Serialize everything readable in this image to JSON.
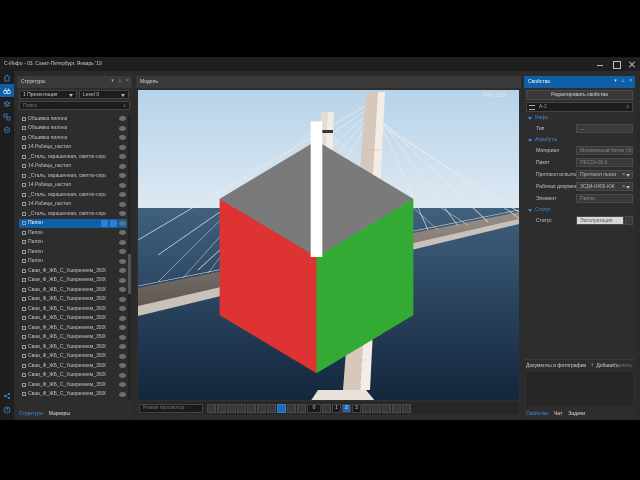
{
  "window": {
    "title": "С-Инфо - 03. Санкт-Петербург. Январь '19"
  },
  "rail": {
    "icons": [
      "home-icon",
      "binoculars-icon",
      "layers-icon",
      "structure-icon",
      "settings-icon",
      "share-icon",
      "help-icon"
    ]
  },
  "structure": {
    "title": "Структура",
    "dropdown1": "1 Презентация",
    "dropdown2": "Level 0",
    "search_placeholder": "Поиск",
    "items": [
      "Обшивка пилона",
      "Обшивка пилона",
      "Обшивка пилона",
      "14.Рабица_настил",
      "_Сталь, окрашенная, светло-серая, мат",
      "14.Рабица_настил",
      "_Сталь, окрашенная, светло-серая, мат",
      "14.Рабица_настил",
      "_Сталь, окрашенная, светло-серая, мат",
      "14.Рабица_настил",
      "_Сталь, окрашенная, светло-серая, мат",
      "Пилон",
      "Пилон",
      "Пилон",
      "Пилон",
      "Пилон",
      "Сваи_Ф_ЖБ_С_Уширением_3500/150...",
      "Сваи_Ф_ЖБ_С_Уширением_3500/150...",
      "Сваи_Ф_ЖБ_С_Уширением_3500/150...",
      "Сваи_Ф_ЖБ_С_Уширением_3500/150...",
      "Сваи_Ф_ЖБ_С_Уширением_3500/150...",
      "Сваи_Ф_ЖБ_С_Уширением_3500/150...",
      "Сваи_Ф_ЖБ_С_Уширением_3500/150...",
      "Сваи_Ф_ЖБ_С_Уширением_3500/150...",
      "Сваи_Ф_ЖБ_С_Уширением_3500/150...",
      "Сваи_Ф_ЖБ_С_Уширением_3500/150...",
      "Сваи_Ф_ЖБ_С_Уширением_3500/150...",
      "Сваи_Ф_ЖБ_С_Уширением_3500/150...",
      "Сваи_Ф_ЖБ_С_Уширением_3500/150...",
      "Сваи_Ф_ЖБ_С_Уширением_3500/150..."
    ],
    "selected_index": 11,
    "tabs": [
      "Структура",
      "Маркеры"
    ]
  },
  "model": {
    "title": "Модель",
    "fps": "FPS: 15.0",
    "view_search_placeholder": "Режим просмотра",
    "zoom_value": "0",
    "pages": [
      "1",
      "2",
      "3"
    ]
  },
  "properties": {
    "title": "Свойства",
    "edit_button": "Редактировать свойства",
    "search_value": "A-2",
    "sections": {
      "info": "Инфо",
      "attributes": "Атрибуты",
      "status": "Статус"
    },
    "info_rows": [
      {
        "key": "Тип",
        "value": "..."
      }
    ],
    "attr_rows": [
      {
        "key": "Материал",
        "value": "Монолитный бетон (Зол"
      },
      {
        "key": "Пикет",
        "value": "ПК123+00,6"
      },
      {
        "key": "Протокол испытаний",
        "value": "Протокол пьезо"
      },
      {
        "key": "Рабочая документация",
        "value": "ЗСД4-0405-КЖ"
      },
      {
        "key": "Элемент",
        "value": "Пилон"
      }
    ],
    "status_rows": [
      {
        "key": "Статус",
        "value": "Эксплуатация"
      }
    ],
    "docs_title": "Документы и фотографии",
    "docs_add": "Добавить",
    "docs_delete": "Удалить",
    "tabs": [
      "Свойства",
      "Чат",
      "Задачи"
    ]
  },
  "colors": {
    "accent": "#0f5fa8",
    "panel": "#2d2d2d",
    "water": "#1f3a5c"
  }
}
